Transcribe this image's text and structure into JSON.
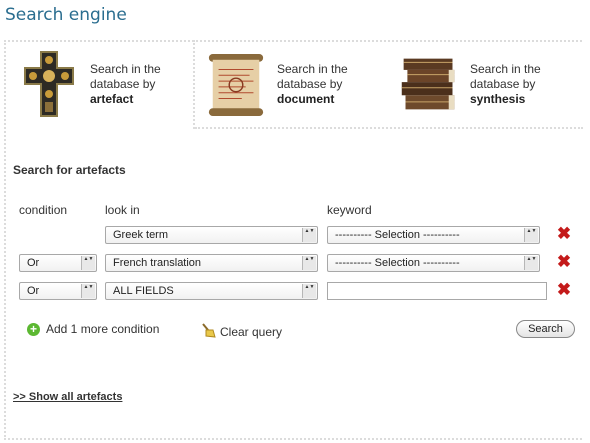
{
  "header": {
    "title": "Search engine"
  },
  "tabs": [
    {
      "line1": "Search in the",
      "line2": "database by",
      "bold": "artefact",
      "icon": "cross-icon"
    },
    {
      "line1": "Search in the",
      "line2": "database by",
      "bold": "document",
      "icon": "scroll-icon"
    },
    {
      "line1": "Search in the",
      "line2": "database by",
      "bold": "synthesis",
      "icon": "books-icon"
    }
  ],
  "form": {
    "title": "Search for artefacts",
    "columns": {
      "condition": "condition",
      "look_in": "look in",
      "keyword": "keyword"
    },
    "rows": [
      {
        "condition": "",
        "look_in": "Greek term",
        "keyword": "---------- Selection ----------"
      },
      {
        "condition": "Or",
        "look_in": "French translation",
        "keyword": "---------- Selection ----------"
      },
      {
        "condition": "Or",
        "look_in": "ALL FIELDS",
        "keyword": ""
      }
    ],
    "add_condition": "Add 1 more condition",
    "clear_query": "Clear query",
    "search_button": "Search"
  },
  "footer": {
    "show_all": ">> Show all artefacts"
  },
  "colors": {
    "title": "#2a6d8f",
    "delete": "#c41a1a",
    "add": "#5cb832"
  }
}
